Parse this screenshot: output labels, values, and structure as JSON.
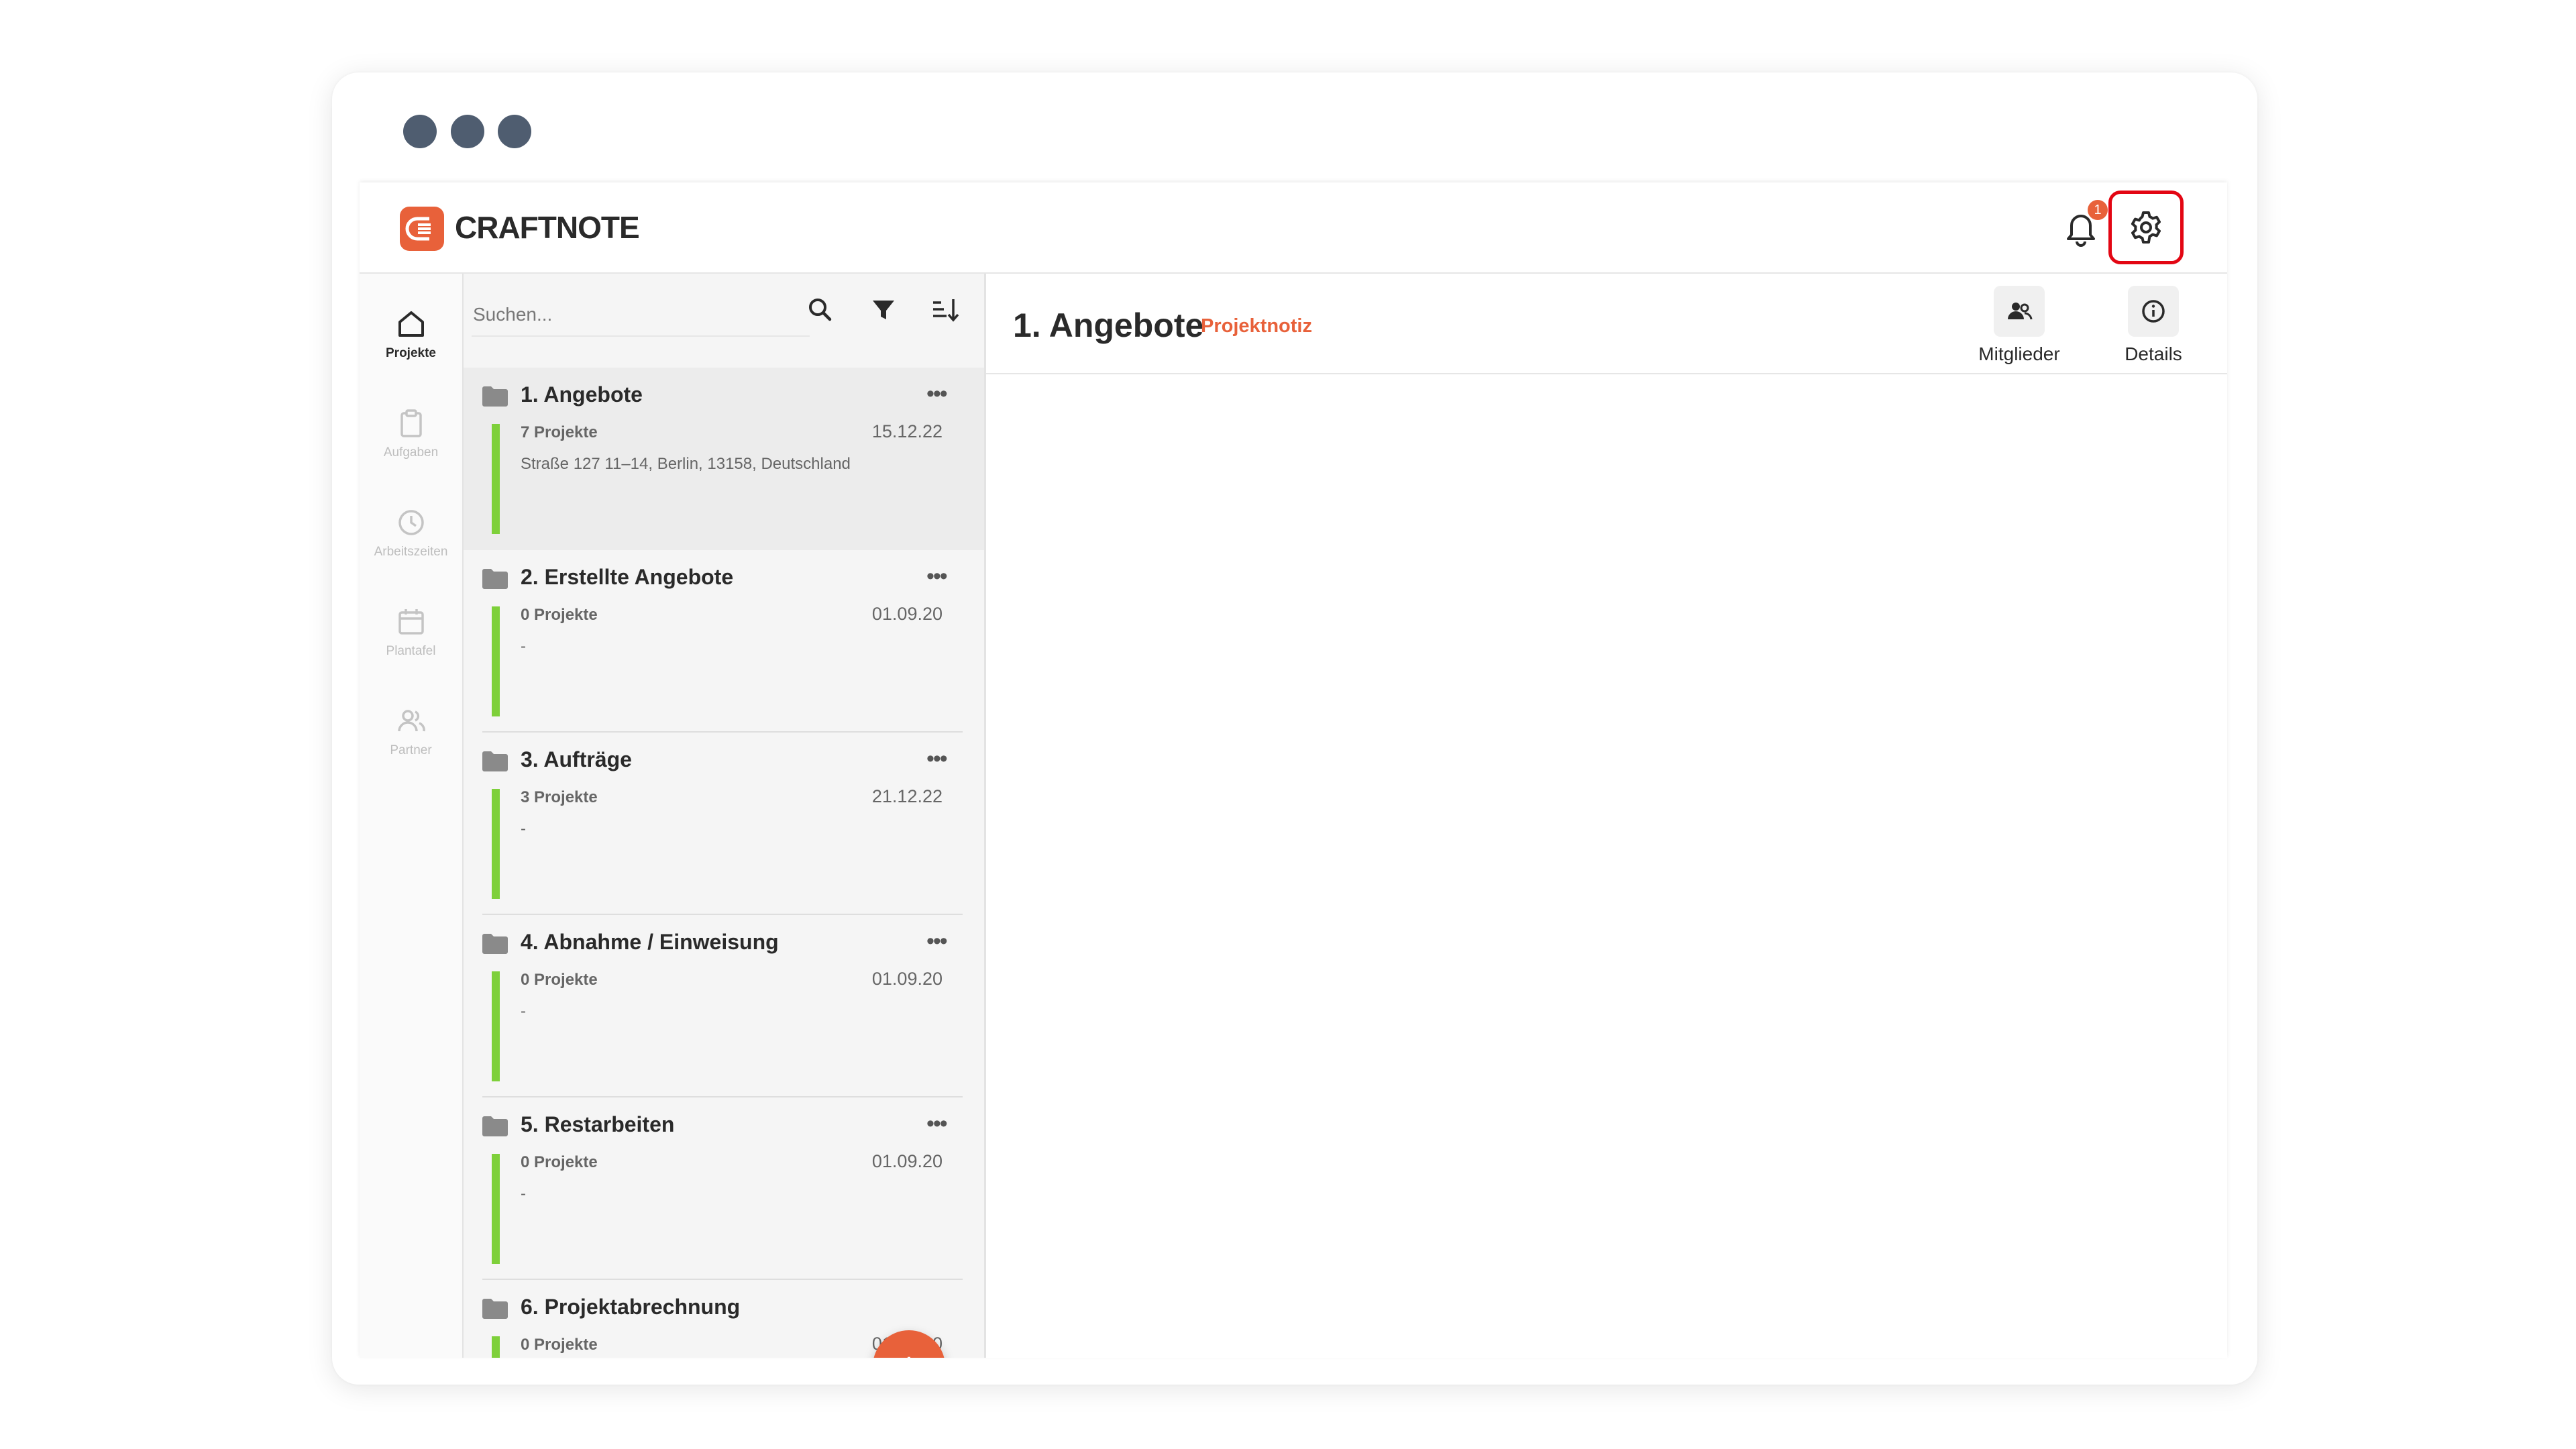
{
  "app": {
    "brand": "CRAFTNOTE",
    "notification_count": "1"
  },
  "colors": {
    "accent": "#e8613a",
    "status_bar": "#7ed03a",
    "highlight_border": "#e30613",
    "window_dots": "#4f5d70"
  },
  "sidebar": {
    "items": [
      {
        "label": "Projekte",
        "icon": "home-icon",
        "active": true
      },
      {
        "label": "Aufgaben",
        "icon": "clipboard-icon",
        "active": false
      },
      {
        "label": "Arbeitszeiten",
        "icon": "clock-icon",
        "active": false
      },
      {
        "label": "Plantafel",
        "icon": "calendar-icon",
        "active": false
      },
      {
        "label": "Partner",
        "icon": "people-icon",
        "active": false
      }
    ]
  },
  "list": {
    "search_placeholder": "Suchen...",
    "folders": [
      {
        "name": "1. Angebote",
        "count": "7 Projekte",
        "date": "15.12.22",
        "address": "Straße 127 11–14, Berlin, 13158, Deutschland",
        "selected": true
      },
      {
        "name": "2. Erstellte Angebote",
        "count": "0 Projekte",
        "date": "01.09.20",
        "address": "-"
      },
      {
        "name": "3. Aufträge",
        "count": "3 Projekte",
        "date": "21.12.22",
        "address": "-"
      },
      {
        "name": "4. Abnahme / Einweisung",
        "count": "0 Projekte",
        "date": "01.09.20",
        "address": "-"
      },
      {
        "name": "5. Restarbeiten",
        "count": "0 Projekte",
        "date": "01.09.20",
        "address": "-"
      },
      {
        "name": "6. Projektabrechnung",
        "count": "0 Projekte",
        "date": "01.09.20",
        "address": ""
      }
    ],
    "fab_label": "+",
    "more_label": "•••"
  },
  "main": {
    "title": "1. Angebote",
    "subtitle": "Projektnotiz",
    "actions": [
      {
        "label": "Mitglieder",
        "icon": "members-icon"
      },
      {
        "label": "Details",
        "icon": "info-icon"
      }
    ]
  }
}
